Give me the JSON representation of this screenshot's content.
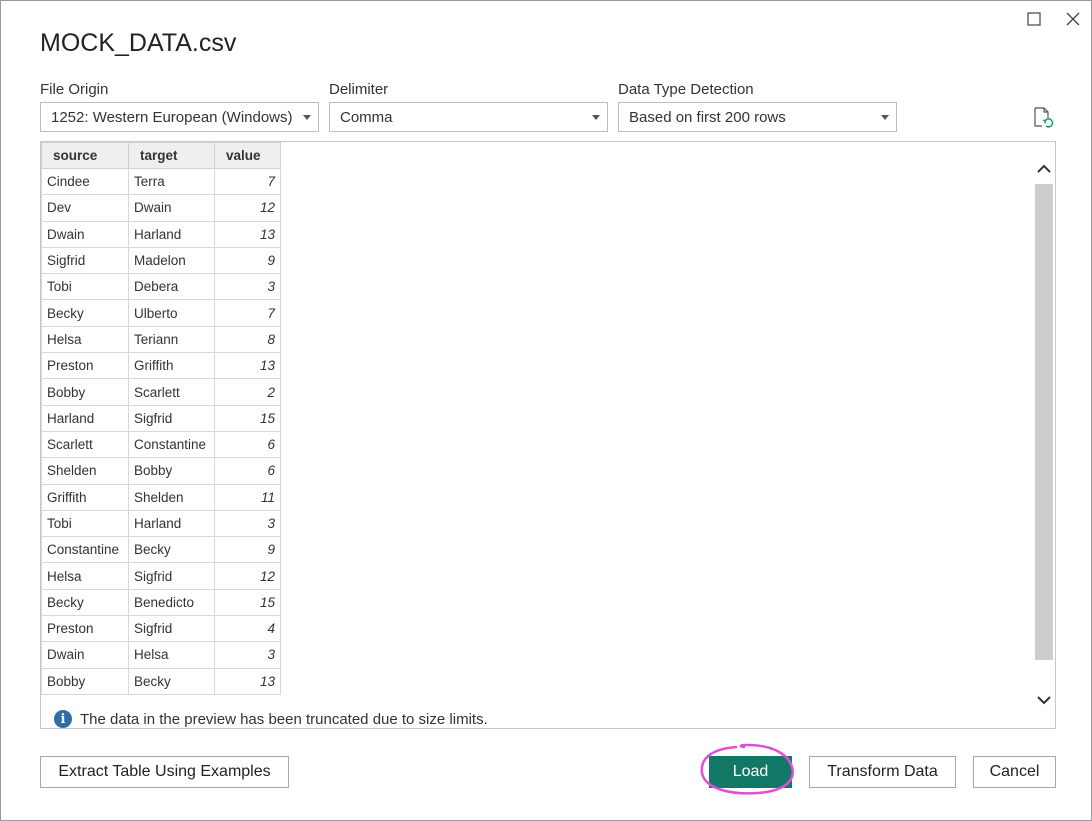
{
  "dialog": {
    "title": "MOCK_DATA.csv"
  },
  "options": {
    "file_origin": {
      "label": "File Origin",
      "value": "1252: Western European (Windows)"
    },
    "delimiter": {
      "label": "Delimiter",
      "value": "Comma"
    },
    "data_type_detection": {
      "label": "Data Type Detection",
      "value": "Based on first 200 rows"
    }
  },
  "table": {
    "headers": [
      "source",
      "target",
      "value"
    ],
    "rows": [
      [
        "Cindee",
        "Terra",
        "7"
      ],
      [
        "Dev",
        "Dwain",
        "12"
      ],
      [
        "Dwain",
        "Harland",
        "13"
      ],
      [
        "Sigfrid",
        "Madelon",
        "9"
      ],
      [
        "Tobi",
        "Debera",
        "3"
      ],
      [
        "Becky",
        "Ulberto",
        "7"
      ],
      [
        "Helsa",
        "Teriann",
        "8"
      ],
      [
        "Preston",
        "Griffith",
        "13"
      ],
      [
        "Bobby",
        "Scarlett",
        "2"
      ],
      [
        "Harland",
        "Sigfrid",
        "15"
      ],
      [
        "Scarlett",
        "Constantine",
        "6"
      ],
      [
        "Shelden",
        "Bobby",
        "6"
      ],
      [
        "Griffith",
        "Shelden",
        "11"
      ],
      [
        "Tobi",
        "Harland",
        "3"
      ],
      [
        "Constantine",
        "Becky",
        "9"
      ],
      [
        "Helsa",
        "Sigfrid",
        "12"
      ],
      [
        "Becky",
        "Benedicto",
        "15"
      ],
      [
        "Preston",
        "Sigfrid",
        "4"
      ],
      [
        "Dwain",
        "Helsa",
        "3"
      ],
      [
        "Bobby",
        "Becky",
        "13"
      ]
    ]
  },
  "notice": "The data in the preview has been truncated due to size limits.",
  "buttons": {
    "extract": "Extract Table Using Examples",
    "load": "Load",
    "transform": "Transform Data",
    "cancel": "Cancel"
  },
  "colors": {
    "primary_button": "#117865",
    "highlight_circle": "#e04fd6",
    "info_icon": "#2e6ea6"
  }
}
